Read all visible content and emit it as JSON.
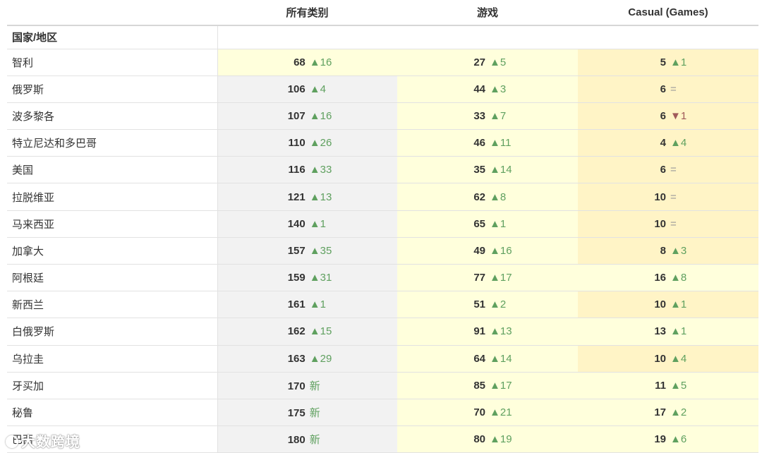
{
  "header": {
    "country_col": "",
    "columns": [
      "所有类别",
      "游戏",
      "Casual (Games)"
    ]
  },
  "subheader": {
    "label": "国家/地区"
  },
  "rows": [
    {
      "country": "智利",
      "cells": [
        {
          "rank": "68",
          "chg": "▲16",
          "dir": "up",
          "bg": "light"
        },
        {
          "rank": "27",
          "chg": "▲5",
          "dir": "up",
          "bg": "light"
        },
        {
          "rank": "5",
          "chg": "▲1",
          "dir": "up",
          "bg": "mid"
        }
      ]
    },
    {
      "country": "俄罗斯",
      "cells": [
        {
          "rank": "106",
          "chg": "▲4",
          "dir": "up",
          "bg": "gray"
        },
        {
          "rank": "44",
          "chg": "▲3",
          "dir": "up",
          "bg": "light"
        },
        {
          "rank": "6",
          "chg": "=",
          "dir": "same",
          "bg": "mid"
        }
      ]
    },
    {
      "country": "波多黎各",
      "cells": [
        {
          "rank": "107",
          "chg": "▲16",
          "dir": "up",
          "bg": "gray"
        },
        {
          "rank": "33",
          "chg": "▲7",
          "dir": "up",
          "bg": "light"
        },
        {
          "rank": "6",
          "chg": "▼1",
          "dir": "down",
          "bg": "mid"
        }
      ]
    },
    {
      "country": "特立尼达和多巴哥",
      "cells": [
        {
          "rank": "110",
          "chg": "▲26",
          "dir": "up",
          "bg": "gray"
        },
        {
          "rank": "46",
          "chg": "▲11",
          "dir": "up",
          "bg": "light"
        },
        {
          "rank": "4",
          "chg": "▲4",
          "dir": "up",
          "bg": "mid"
        }
      ]
    },
    {
      "country": "美国",
      "cells": [
        {
          "rank": "116",
          "chg": "▲33",
          "dir": "up",
          "bg": "gray"
        },
        {
          "rank": "35",
          "chg": "▲14",
          "dir": "up",
          "bg": "light"
        },
        {
          "rank": "6",
          "chg": "=",
          "dir": "same",
          "bg": "mid"
        }
      ]
    },
    {
      "country": "拉脱维亚",
      "cells": [
        {
          "rank": "121",
          "chg": "▲13",
          "dir": "up",
          "bg": "gray"
        },
        {
          "rank": "62",
          "chg": "▲8",
          "dir": "up",
          "bg": "light"
        },
        {
          "rank": "10",
          "chg": "=",
          "dir": "same",
          "bg": "mid"
        }
      ]
    },
    {
      "country": "马来西亚",
      "cells": [
        {
          "rank": "140",
          "chg": "▲1",
          "dir": "up",
          "bg": "gray"
        },
        {
          "rank": "65",
          "chg": "▲1",
          "dir": "up",
          "bg": "light"
        },
        {
          "rank": "10",
          "chg": "=",
          "dir": "same",
          "bg": "mid"
        }
      ]
    },
    {
      "country": "加拿大",
      "cells": [
        {
          "rank": "157",
          "chg": "▲35",
          "dir": "up",
          "bg": "gray"
        },
        {
          "rank": "49",
          "chg": "▲16",
          "dir": "up",
          "bg": "light"
        },
        {
          "rank": "8",
          "chg": "▲3",
          "dir": "up",
          "bg": "mid"
        }
      ]
    },
    {
      "country": "阿根廷",
      "cells": [
        {
          "rank": "159",
          "chg": "▲31",
          "dir": "up",
          "bg": "gray"
        },
        {
          "rank": "77",
          "chg": "▲17",
          "dir": "up",
          "bg": "light"
        },
        {
          "rank": "16",
          "chg": "▲8",
          "dir": "up",
          "bg": "light"
        }
      ]
    },
    {
      "country": "新西兰",
      "cells": [
        {
          "rank": "161",
          "chg": "▲1",
          "dir": "up",
          "bg": "gray"
        },
        {
          "rank": "51",
          "chg": "▲2",
          "dir": "up",
          "bg": "light"
        },
        {
          "rank": "10",
          "chg": "▲1",
          "dir": "up",
          "bg": "mid"
        }
      ]
    },
    {
      "country": "白俄罗斯",
      "cells": [
        {
          "rank": "162",
          "chg": "▲15",
          "dir": "up",
          "bg": "gray"
        },
        {
          "rank": "91",
          "chg": "▲13",
          "dir": "up",
          "bg": "light"
        },
        {
          "rank": "13",
          "chg": "▲1",
          "dir": "up",
          "bg": "light"
        }
      ]
    },
    {
      "country": "乌拉圭",
      "cells": [
        {
          "rank": "163",
          "chg": "▲29",
          "dir": "up",
          "bg": "gray"
        },
        {
          "rank": "64",
          "chg": "▲14",
          "dir": "up",
          "bg": "light"
        },
        {
          "rank": "10",
          "chg": "▲4",
          "dir": "up",
          "bg": "mid"
        }
      ]
    },
    {
      "country": "牙买加",
      "cells": [
        {
          "rank": "170",
          "chg": "新",
          "dir": "new",
          "bg": "gray"
        },
        {
          "rank": "85",
          "chg": "▲17",
          "dir": "up",
          "bg": "light"
        },
        {
          "rank": "11",
          "chg": "▲5",
          "dir": "up",
          "bg": "light"
        }
      ]
    },
    {
      "country": "秘鲁",
      "cells": [
        {
          "rank": "175",
          "chg": "新",
          "dir": "new",
          "bg": "gray"
        },
        {
          "rank": "70",
          "chg": "▲21",
          "dir": "up",
          "bg": "light"
        },
        {
          "rank": "17",
          "chg": "▲2",
          "dir": "up",
          "bg": "light"
        }
      ]
    },
    {
      "country": "巴西",
      "cells": [
        {
          "rank": "180",
          "chg": "新",
          "dir": "new",
          "bg": "gray"
        },
        {
          "rank": "80",
          "chg": "▲19",
          "dir": "up",
          "bg": "light"
        },
        {
          "rank": "19",
          "chg": "▲6",
          "dir": "up",
          "bg": "light"
        }
      ]
    }
  ],
  "watermark": {
    "text": "大数跨境"
  },
  "colors": {
    "up": "#5fa05f",
    "down": "#a05a5a",
    "same": "#999999",
    "gray_bg": "#f2f2f2",
    "light_bg": "#ffffdc",
    "mid_bg": "#fff4c6"
  }
}
